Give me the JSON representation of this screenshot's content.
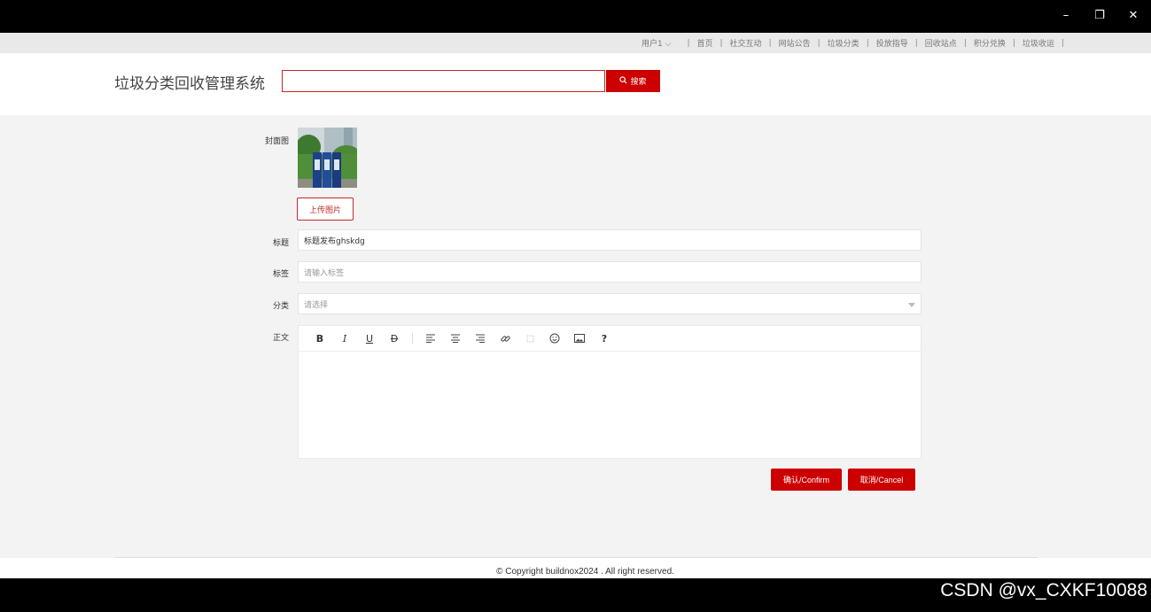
{
  "window": {
    "minimize_glyph": "–",
    "restore_glyph": "❐",
    "close_glyph": "✕"
  },
  "topnav": {
    "user_label": "用户1",
    "items": [
      {
        "label": "首页"
      },
      {
        "label": "社交互动",
        "active": true
      },
      {
        "label": "网站公告"
      },
      {
        "label": "垃圾分类"
      },
      {
        "label": "投放指导"
      },
      {
        "label": "回收站点"
      },
      {
        "label": "积分兑换"
      },
      {
        "label": "垃圾收运"
      }
    ],
    "separator": "|",
    "active_color": "#3cb371"
  },
  "header": {
    "site_title": "垃圾分类回收管理系统",
    "search_value": "",
    "search_button_label": "搜索",
    "accent_color": "#cc0000"
  },
  "form": {
    "cover_label": "封面图",
    "upload_label": "上传图片",
    "title_label": "标题",
    "title_value": "标题发布ghskdg",
    "tags_label": "标签",
    "tags_placeholder": "请输入标签",
    "category_label": "分类",
    "category_placeholder": "请选择",
    "body_label": "正文",
    "toolbar_icons": [
      "bold-icon",
      "italic-icon",
      "underline-icon",
      "strikethrough-icon",
      "align-left-icon",
      "align-center-icon",
      "align-right-icon",
      "link-icon",
      "unlink-icon",
      "emoji-icon",
      "image-icon",
      "help-icon"
    ],
    "confirm_label": "确认/Confirm",
    "cancel_label": "取消/Cancel"
  },
  "footer": {
    "copyright": "© Copyright buildnox2024 . All right reserved."
  },
  "watermark": "CSDN @vx_CXKF10088"
}
